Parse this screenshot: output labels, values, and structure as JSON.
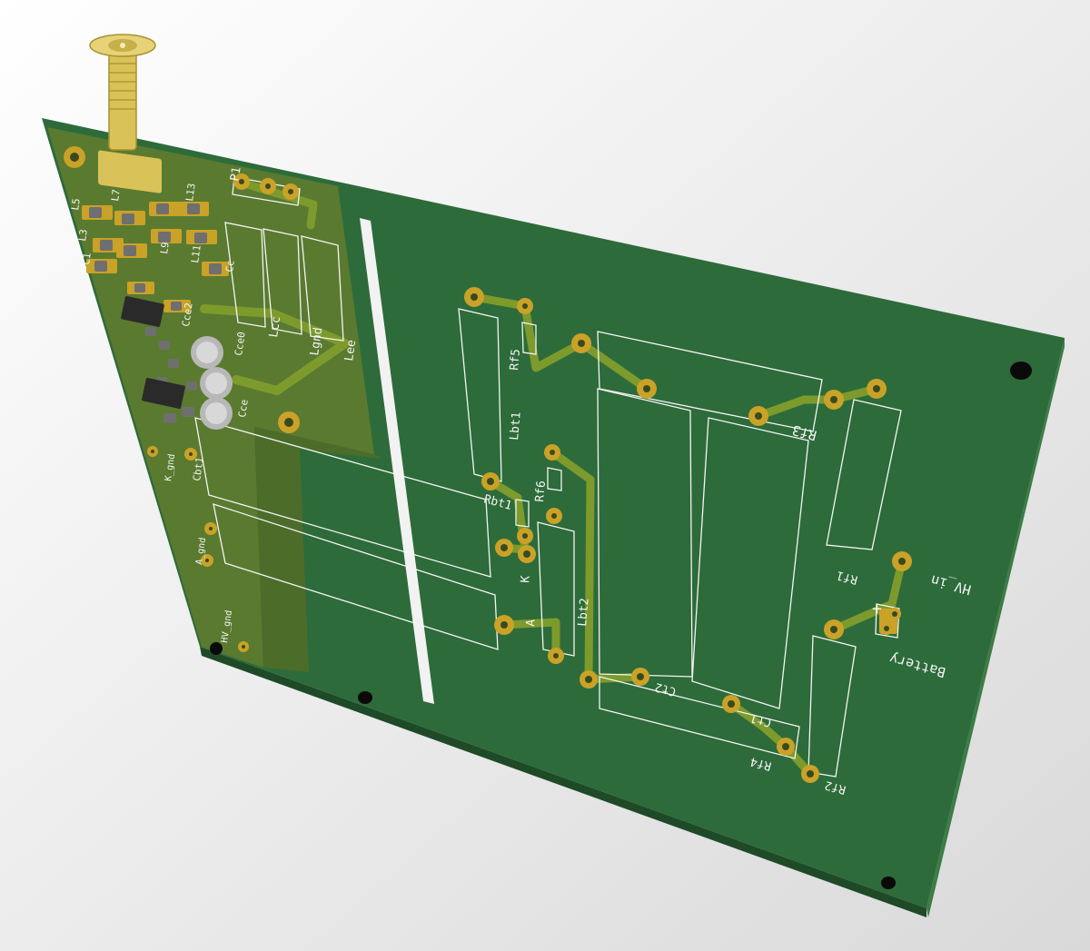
{
  "scene": {
    "background": {
      "light": "#ffffff",
      "dark": "#d9d9d9"
    },
    "colors": {
      "board_top": "#2d6b3a",
      "board_edge": "#1f4a28",
      "board_side": "#3c7d45",
      "rf_region": "#5a7a30",
      "rf_region_dark": "#4c6c2a",
      "pad": "#c9a227",
      "pad_hole": "#3a4a20",
      "trace": "#7d9a2c",
      "silkscreen": "#f4f4f4",
      "smd_body": "#6f6f6f",
      "ic_body": "#2a2a2a",
      "cap_can": "#b8b8b8",
      "connector_gold": "#d9c257",
      "mount_hole": "#0a0a0a"
    }
  },
  "connector": {
    "ref": "P1",
    "icon": "sma-connector-icon"
  },
  "labels": {
    "p1": "P1",
    "lcc": "Lcc",
    "lgnd": "Lgnd",
    "lee": "Lee",
    "cc": "Cc",
    "l5": "L5",
    "l3": "L3",
    "l7": "L7",
    "l9": "L9",
    "l11": "L11",
    "l13": "L13",
    "c1": "C1",
    "cce2": "Cce2",
    "cce0": "Cce0",
    "cce": "Cce",
    "cbt1": "Cbt1",
    "k_gnd": "K_gnd",
    "a_gnd": "A_gnd",
    "lbt1": "Lbt1",
    "lbt2": "Lbt2",
    "rf5": "Rf5",
    "rf6": "Rf6",
    "rbt": "Rbt1",
    "k": "K",
    "a": "A",
    "rf3": "Rf3",
    "rf1": "Rf1",
    "hv_in": "HV_in",
    "battery": "Battery",
    "ct2": "Ct2",
    "ct1": "Ct1",
    "rf4": "Rf4",
    "rf2": "Rf2",
    "plus": "+",
    "hv_gnd": "HV_gnd"
  }
}
